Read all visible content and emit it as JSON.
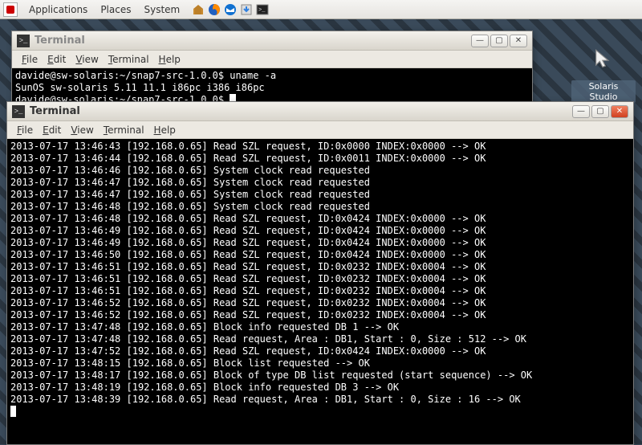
{
  "taskbar": {
    "menu": [
      "Applications",
      "Places",
      "System"
    ],
    "icons": [
      "home-icon",
      "firefox-icon",
      "thunderbird-icon",
      "updater-icon",
      "terminal-icon"
    ]
  },
  "desktop": {
    "studio": {
      "label": "Solaris Studio"
    }
  },
  "window_back": {
    "title": "Terminal",
    "menu": [
      {
        "label": "File",
        "u": 0
      },
      {
        "label": "Edit",
        "u": 0
      },
      {
        "label": "View",
        "u": 0
      },
      {
        "label": "Terminal",
        "u": 0
      },
      {
        "label": "Help",
        "u": 0
      }
    ],
    "lines": [
      "davide@sw-solaris:~/snap7-src-1.0.0$ uname -a",
      "SunOS sw-solaris 5.11 11.1 i86pc i386 i86pc",
      "davide@sw-solaris:~/snap7-src-1.0.0$ "
    ]
  },
  "window_front": {
    "title": "Terminal",
    "menu": [
      {
        "label": "File",
        "u": 0
      },
      {
        "label": "Edit",
        "u": 0
      },
      {
        "label": "View",
        "u": 0
      },
      {
        "label": "Terminal",
        "u": 0
      },
      {
        "label": "Help",
        "u": 0
      }
    ],
    "lines": [
      "2013-07-17 13:46:43 [192.168.0.65] Read SZL request, ID:0x0000 INDEX:0x0000 --> OK",
      "2013-07-17 13:46:44 [192.168.0.65] Read SZL request, ID:0x0011 INDEX:0x0000 --> OK",
      "2013-07-17 13:46:46 [192.168.0.65] System clock read requested",
      "2013-07-17 13:46:47 [192.168.0.65] System clock read requested",
      "2013-07-17 13:46:47 [192.168.0.65] System clock read requested",
      "2013-07-17 13:46:48 [192.168.0.65] System clock read requested",
      "2013-07-17 13:46:48 [192.168.0.65] Read SZL request, ID:0x0424 INDEX:0x0000 --> OK",
      "2013-07-17 13:46:49 [192.168.0.65] Read SZL request, ID:0x0424 INDEX:0x0000 --> OK",
      "2013-07-17 13:46:49 [192.168.0.65] Read SZL request, ID:0x0424 INDEX:0x0000 --> OK",
      "2013-07-17 13:46:50 [192.168.0.65] Read SZL request, ID:0x0424 INDEX:0x0000 --> OK",
      "2013-07-17 13:46:51 [192.168.0.65] Read SZL request, ID:0x0232 INDEX:0x0004 --> OK",
      "2013-07-17 13:46:51 [192.168.0.65] Read SZL request, ID:0x0232 INDEX:0x0004 --> OK",
      "2013-07-17 13:46:51 [192.168.0.65] Read SZL request, ID:0x0232 INDEX:0x0004 --> OK",
      "2013-07-17 13:46:52 [192.168.0.65] Read SZL request, ID:0x0232 INDEX:0x0004 --> OK",
      "2013-07-17 13:46:52 [192.168.0.65] Read SZL request, ID:0x0232 INDEX:0x0004 --> OK",
      "2013-07-17 13:47:48 [192.168.0.65] Block info requested DB 1 --> OK",
      "2013-07-17 13:47:48 [192.168.0.65] Read request, Area : DB1, Start : 0, Size : 512 --> OK",
      "2013-07-17 13:47:52 [192.168.0.65] Read SZL request, ID:0x0424 INDEX:0x0000 --> OK",
      "2013-07-17 13:48:15 [192.168.0.65] Block list requested --> OK",
      "2013-07-17 13:48:17 [192.168.0.65] Block of type DB list requested (start sequence) --> OK",
      "2013-07-17 13:48:19 [192.168.0.65] Block info requested DB 3 --> OK",
      "2013-07-17 13:48:39 [192.168.0.65] Read request, Area : DB1, Start : 0, Size : 16 --> OK"
    ]
  }
}
